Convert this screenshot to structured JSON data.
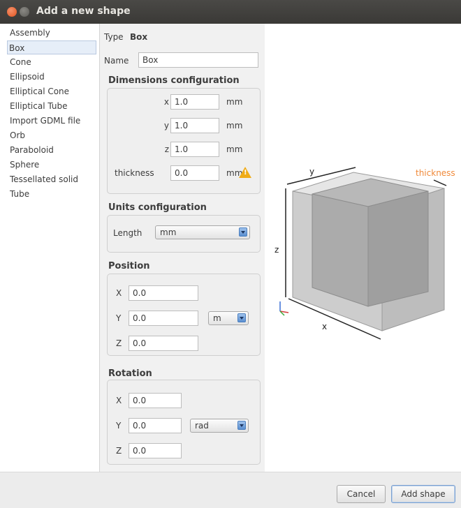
{
  "window": {
    "title": "Add a new shape"
  },
  "sidebar": {
    "items": [
      {
        "label": "Assembly"
      },
      {
        "label": "Box",
        "selected": true
      },
      {
        "label": "Cone"
      },
      {
        "label": "Ellipsoid"
      },
      {
        "label": "Elliptical Cone"
      },
      {
        "label": "Elliptical Tube"
      },
      {
        "label": "Import GDML file"
      },
      {
        "label": "Orb"
      },
      {
        "label": "Paraboloid"
      },
      {
        "label": "Sphere"
      },
      {
        "label": "Tessellated solid"
      },
      {
        "label": "Tube"
      }
    ]
  },
  "form": {
    "type_label": "Type",
    "type_value": "Box",
    "name_label": "Name",
    "name_value": "Box",
    "dimensions": {
      "title": "Dimensions configuration",
      "x_label": "x",
      "x_value": "1.0",
      "x_unit": "mm",
      "y_label": "y",
      "y_value": "1.0",
      "y_unit": "mm",
      "z_label": "z",
      "z_value": "1.0",
      "z_unit": "mm",
      "thickness_label": "thickness",
      "thickness_value": "0.0",
      "thickness_unit": "mm"
    },
    "units": {
      "title": "Units configuration",
      "length_label": "Length",
      "length_value": "mm"
    },
    "position": {
      "title": "Position",
      "x_label": "X",
      "x_value": "0.0",
      "y_label": "Y",
      "y_value": "0.0",
      "z_label": "Z",
      "z_value": "0.0",
      "unit": "m"
    },
    "rotation": {
      "title": "Rotation",
      "x_label": "X",
      "x_value": "0.0",
      "y_label": "Y",
      "y_value": "0.0",
      "z_label": "Z",
      "z_value": "0.0",
      "unit": "rad"
    }
  },
  "preview": {
    "y_label": "y",
    "z_label": "z",
    "x_label": "x",
    "thickness_label": "thickness",
    "colors": {
      "thickness": "#f08a3a"
    }
  },
  "footer": {
    "cancel_label": "Cancel",
    "add_label": "Add shape"
  }
}
